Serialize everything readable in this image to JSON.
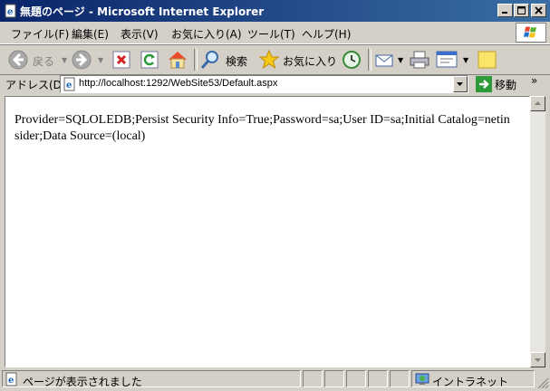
{
  "window": {
    "title": "無題のページ - Microsoft Internet Explorer"
  },
  "menu": {
    "items": [
      "ファイル(F)",
      "編集(E)",
      "表示(V)",
      "お気に入り(A)",
      "ツール(T)",
      "ヘルプ(H)"
    ]
  },
  "toolbar": {
    "back_label": "戻る",
    "search_label": "検索",
    "favorites_label": "お気に入り"
  },
  "address": {
    "label": "アドレス(D)",
    "url": "http://localhost:1292/WebSite53/Default.aspx",
    "go_label": "移動",
    "links_chevron": "»"
  },
  "content": {
    "text": "Provider=SQLOLEDB;Persist Security Info=True;Password=sa;User ID=sa;Initial Catalog=netinsider;Data Source=(local)"
  },
  "status": {
    "message": "ページが表示されました",
    "zone": "イントラネット"
  },
  "colors": {
    "titlebar_start": "#0a246a",
    "titlebar_end": "#3a6ea5",
    "chrome": "#d4d0c8"
  }
}
